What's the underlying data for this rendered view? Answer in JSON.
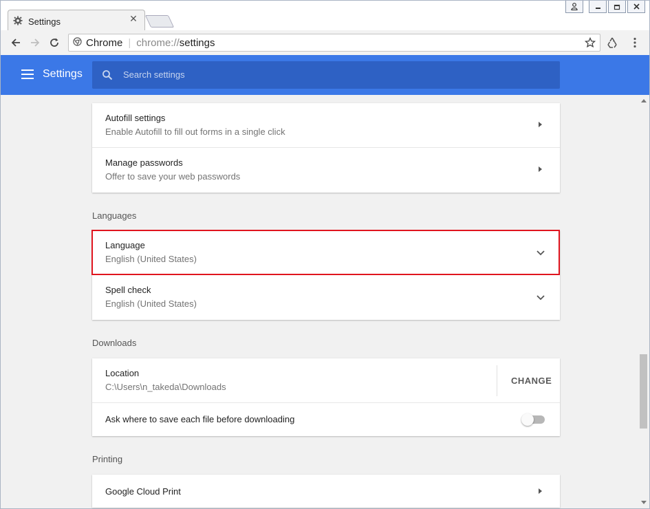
{
  "window": {
    "tab_title": "Settings",
    "tab_icon": "gear-icon",
    "controls": [
      "user-icon",
      "minimize-icon",
      "restore-icon",
      "close-icon"
    ]
  },
  "toolbar": {
    "omnibox_site": "Chrome",
    "omnibox_scheme": "chrome://",
    "omnibox_path": "settings"
  },
  "header": {
    "title": "Settings",
    "search_placeholder": "Search settings"
  },
  "autofill_card": {
    "rows": [
      {
        "title": "Autofill settings",
        "subtitle": "Enable Autofill to fill out forms in a single click"
      },
      {
        "title": "Manage passwords",
        "subtitle": "Offer to save your web passwords"
      }
    ]
  },
  "languages": {
    "section_label": "Languages",
    "rows": [
      {
        "title": "Language",
        "subtitle": "English (United States)"
      },
      {
        "title": "Spell check",
        "subtitle": "English (United States)"
      }
    ]
  },
  "downloads": {
    "section_label": "Downloads",
    "location_title": "Location",
    "location_value": "C:\\Users\\n_takeda\\Downloads",
    "change_label": "CHANGE",
    "ask_label": "Ask where to save each file before downloading",
    "ask_enabled": false
  },
  "printing": {
    "section_label": "Printing",
    "rows": [
      {
        "title": "Google Cloud Print"
      }
    ]
  },
  "colors": {
    "accent": "#3b78e7",
    "highlight": "#e0141e"
  }
}
